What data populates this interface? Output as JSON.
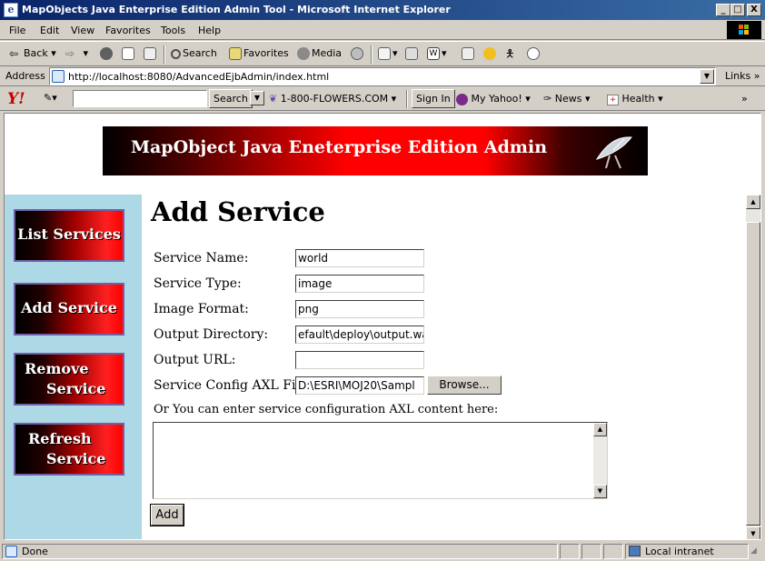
{
  "window": {
    "title": "MapObjects Java Enterprise Edition Admin Tool - Microsoft Internet Explorer",
    "minimize": "_",
    "maximize": "□",
    "close": "X"
  },
  "menu": [
    "File",
    "Edit",
    "View",
    "Favorites",
    "Tools",
    "Help"
  ],
  "toolbar": {
    "back": "Back",
    "search": "Search",
    "favorites": "Favorites",
    "media": "Media"
  },
  "address": {
    "label": "Address",
    "url": "http://localhost:8080/AdvancedEjbAdmin/index.html",
    "links": "Links",
    "more": "»"
  },
  "yahoo": {
    "logo": "Y!",
    "search_button": "Search",
    "flowers": "1-800-FLOWERS.COM",
    "signin": "Sign In",
    "myyahoo": "My Yahoo!",
    "news": "News",
    "health": "Health",
    "more": "»"
  },
  "banner": {
    "text": "MapObject Java Eneterprise Edition Admin"
  },
  "nav": {
    "list": "List Services",
    "add": "Add Service",
    "remove_1": "Remove",
    "remove_2": "Service",
    "refresh_1": "Refresh",
    "refresh_2": "Service"
  },
  "form": {
    "heading": "Add Service",
    "service_name_label": "Service Name:",
    "service_name_value": "world",
    "service_type_label": "Service Type:",
    "service_type_value": "image",
    "image_format_label": "Image Format:",
    "image_format_value": "png",
    "output_dir_label": "Output Directory:",
    "output_dir_value": "efault\\deploy\\output.war",
    "output_url_label": "Output URL:",
    "output_url_value": "",
    "config_label": "Service Config AXL File:",
    "config_value": "D:\\ESRI\\MOJ20\\Sampl",
    "browse": "Browse...",
    "axl_prompt": "Or You can enter service configuration AXL content here:",
    "axl_content": "",
    "add_button": "Add"
  },
  "status": {
    "done": "Done",
    "zone": "Local intranet"
  }
}
